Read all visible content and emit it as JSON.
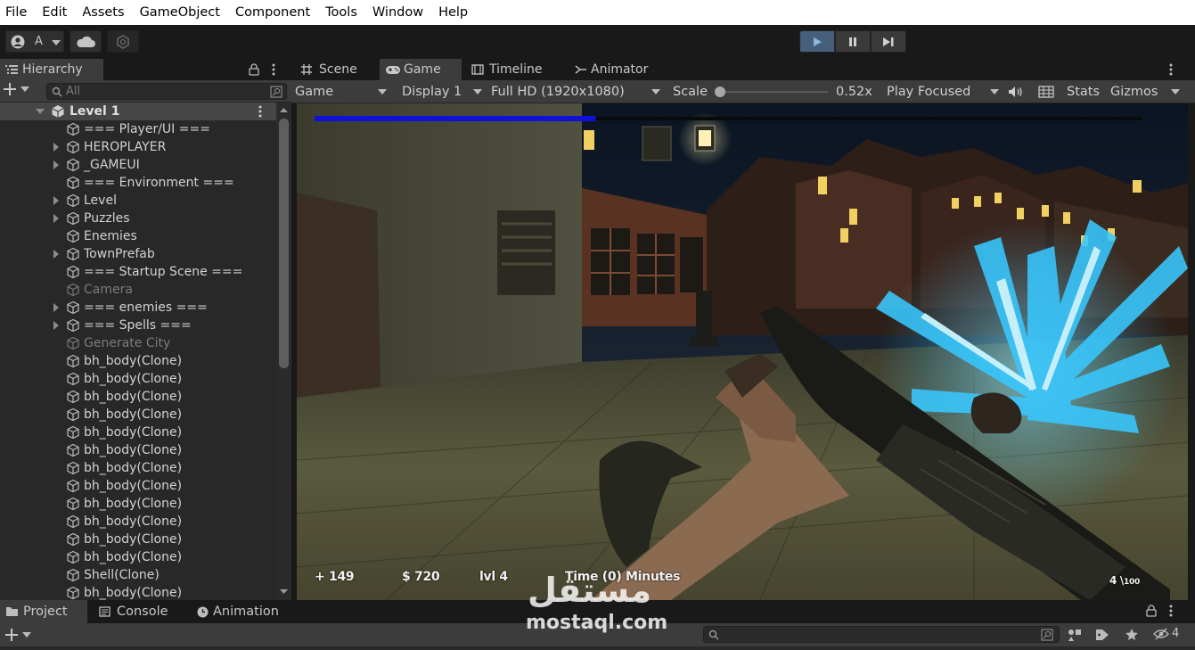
{
  "menu": [
    "File",
    "Edit",
    "Assets",
    "GameObject",
    "Component",
    "Tools",
    "Window",
    "Help"
  ],
  "toolbar": {
    "account_label": "A"
  },
  "hierarchy": {
    "tab_label": "Hierarchy",
    "search_placeholder": "All",
    "root": "Level 1",
    "items": [
      {
        "label": "=== Player/UI ===",
        "expandable": false,
        "dim": false
      },
      {
        "label": "HEROPLAYER",
        "expandable": true,
        "dim": false
      },
      {
        "label": "_GAMEUI",
        "expandable": true,
        "dim": false
      },
      {
        "label": "=== Environment ===",
        "expandable": false,
        "dim": false
      },
      {
        "label": "Level",
        "expandable": true,
        "dim": false
      },
      {
        "label": "Puzzles",
        "expandable": true,
        "dim": false
      },
      {
        "label": "Enemies",
        "expandable": false,
        "dim": false
      },
      {
        "label": "TownPrefab",
        "expandable": true,
        "dim": false
      },
      {
        "label": "=== Startup Scene ===",
        "expandable": false,
        "dim": false
      },
      {
        "label": "Camera",
        "expandable": false,
        "dim": true
      },
      {
        "label": "=== enemies ===",
        "expandable": true,
        "dim": false
      },
      {
        "label": "=== Spells ===",
        "expandable": true,
        "dim": false
      },
      {
        "label": "Generate City",
        "expandable": false,
        "dim": true
      },
      {
        "label": "bh_body(Clone)",
        "expandable": false,
        "dim": false
      },
      {
        "label": "bh_body(Clone)",
        "expandable": false,
        "dim": false
      },
      {
        "label": "bh_body(Clone)",
        "expandable": false,
        "dim": false
      },
      {
        "label": "bh_body(Clone)",
        "expandable": false,
        "dim": false
      },
      {
        "label": "bh_body(Clone)",
        "expandable": false,
        "dim": false
      },
      {
        "label": "bh_body(Clone)",
        "expandable": false,
        "dim": false
      },
      {
        "label": "bh_body(Clone)",
        "expandable": false,
        "dim": false
      },
      {
        "label": "bh_body(Clone)",
        "expandable": false,
        "dim": false
      },
      {
        "label": "bh_body(Clone)",
        "expandable": false,
        "dim": false
      },
      {
        "label": "bh_body(Clone)",
        "expandable": false,
        "dim": false
      },
      {
        "label": "bh_body(Clone)",
        "expandable": false,
        "dim": false
      },
      {
        "label": "bh_body(Clone)",
        "expandable": false,
        "dim": false
      },
      {
        "label": "Shell(Clone)",
        "expandable": false,
        "dim": false
      },
      {
        "label": "bh_body(Clone)",
        "expandable": false,
        "dim": false
      }
    ]
  },
  "view_tabs": [
    "Scene",
    "Game",
    "Timeline",
    "Animator"
  ],
  "game_toolbar": {
    "mode": "Game",
    "display": "Display 1",
    "resolution": "Full HD (1920x1080)",
    "scale_label": "Scale",
    "scale_value": "0.52x",
    "play_mode": "Play Focused",
    "stats": "Stats",
    "gizmos": "Gizmos"
  },
  "hud": {
    "health": "+ 149",
    "money": "$ 720",
    "level": "lvl 4",
    "time": "Time (0) Minutes",
    "ammo": "4 \\",
    "ammo_max": "100",
    "health_bar_fraction": 0.34
  },
  "bottom_tabs": [
    "Project",
    "Console",
    "Animation"
  ],
  "bottom_hidden_count": "4",
  "watermark": {
    "arabic": "مستقل",
    "latin": "mostaql.com"
  },
  "colors": {
    "play_active": "#46607c",
    "health_bar": "#1010d8",
    "crystal": "#38c8ff"
  }
}
